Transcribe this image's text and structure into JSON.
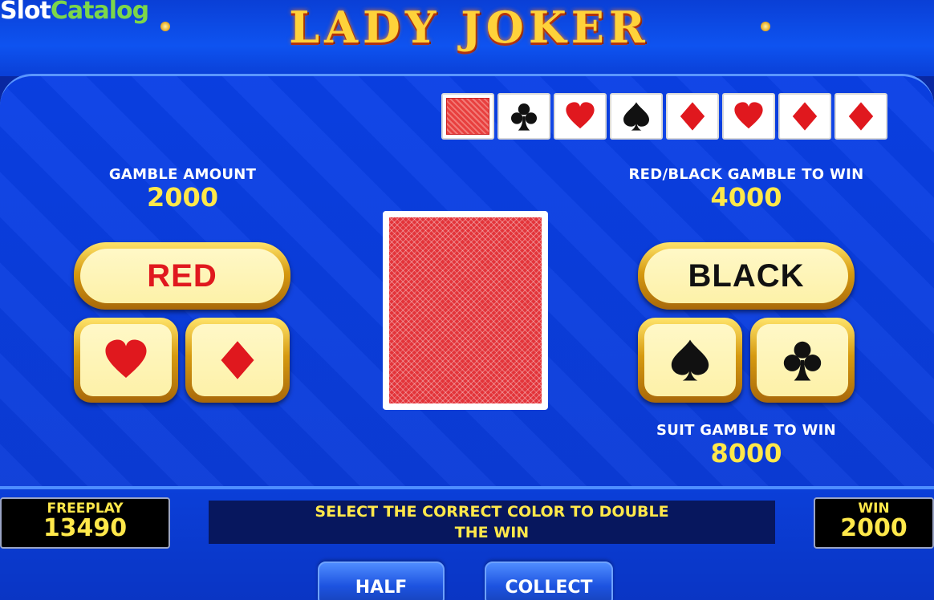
{
  "watermark": {
    "part1": "Slot",
    "part2": "Catalog"
  },
  "title": "LADY JOKER",
  "history": [
    {
      "type": "back",
      "icon": "card-back-icon"
    },
    {
      "type": "suit",
      "suit": "clubs",
      "icon": "club-icon",
      "color": "#111111"
    },
    {
      "type": "suit",
      "suit": "hearts",
      "icon": "heart-icon",
      "color": "#e0181e"
    },
    {
      "type": "suit",
      "suit": "spades",
      "icon": "spade-icon",
      "color": "#111111"
    },
    {
      "type": "suit",
      "suit": "diamonds",
      "icon": "diamond-icon",
      "color": "#e0181e"
    },
    {
      "type": "suit",
      "suit": "hearts",
      "icon": "heart-icon",
      "color": "#e0181e"
    },
    {
      "type": "suit",
      "suit": "diamonds",
      "icon": "diamond-icon",
      "color": "#e0181e"
    },
    {
      "type": "suit",
      "suit": "diamonds",
      "icon": "diamond-icon",
      "color": "#e0181e"
    }
  ],
  "gamble_amount": {
    "label": "GAMBLE AMOUNT",
    "value": "2000"
  },
  "red_black": {
    "label": "RED/BLACK GAMBLE TO WIN",
    "value": "4000"
  },
  "suit_gamble": {
    "label": "SUIT GAMBLE TO WIN",
    "value": "8000"
  },
  "buttons": {
    "red": "RED",
    "black": "BLACK",
    "half": "HALF",
    "collect": "COLLECT"
  },
  "freeplay": {
    "label": "FREEPLAY",
    "value": "13490"
  },
  "win": {
    "label": "WIN",
    "value": "2000"
  },
  "message": {
    "line1": "SELECT THE CORRECT COLOR TO DOUBLE",
    "line2": "THE WIN"
  },
  "colors": {
    "red": "#e0181e",
    "black": "#111111",
    "gold": "#ffe84a",
    "blue": "#0b3cd8"
  }
}
